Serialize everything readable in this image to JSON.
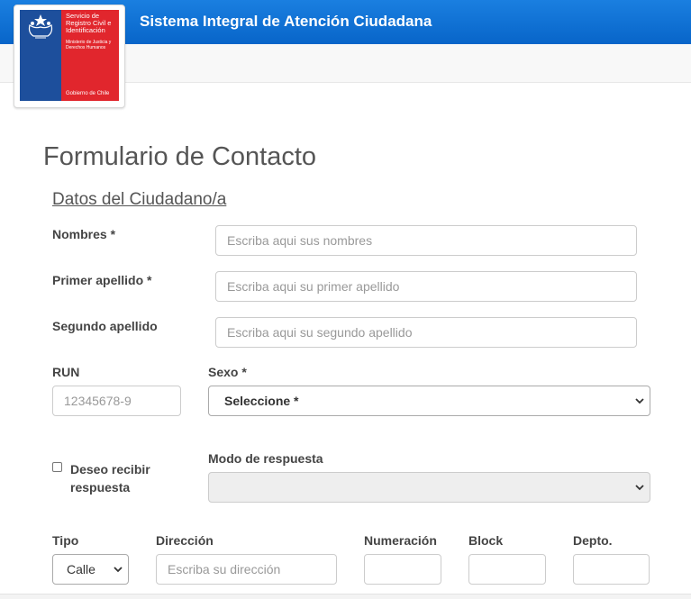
{
  "header": {
    "app_title": "Sistema Integral de Atención Ciudadana",
    "brand_color": "#0a6fd6"
  },
  "logo": {
    "line1": "Servicio de Registro Civil e Identificación",
    "line2": "Ministerio de Justicia y Derechos Humanos",
    "line3": "Gobierno de Chile"
  },
  "form": {
    "title": "Formulario de Contacto",
    "section": "Datos del Ciudadano/a",
    "nombres": {
      "label": "Nombres *",
      "placeholder": "Escriba aqui sus nombres"
    },
    "primer_apellido": {
      "label": "Primer apellido *",
      "placeholder": "Escriba aqui su primer apellido"
    },
    "segundo_apellido": {
      "label": "Segundo apellido",
      "placeholder": "Escriba aqui su segundo apellido"
    },
    "run": {
      "label": "RUN",
      "placeholder": "12345678-9"
    },
    "sexo": {
      "label": "Sexo *",
      "selected": "Seleccione *"
    },
    "respuesta": {
      "label": "Deseo recibir respuesta",
      "checked": false
    },
    "modo_respuesta": {
      "label": "Modo de respuesta",
      "selected": ""
    },
    "tipo": {
      "label": "Tipo",
      "selected": "Calle"
    },
    "direccion": {
      "label": "Dirección",
      "placeholder": "Escriba su dirección"
    },
    "numeracion": {
      "label": "Numeración"
    },
    "block": {
      "label": "Block"
    },
    "depto": {
      "label": "Depto."
    }
  },
  "icons": {
    "crest": "chile-coat-of-arms-icon",
    "dropdown": "chevron-down-icon"
  }
}
